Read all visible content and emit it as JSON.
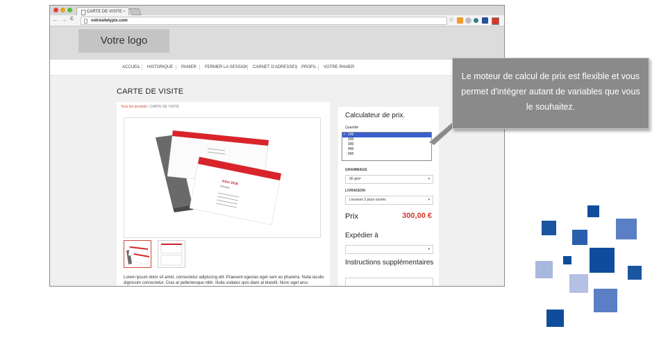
{
  "browser": {
    "tab_title": "CARTE DE VISITE",
    "tab_close": "×",
    "url": "votresitelypix.com",
    "nav_back": "←",
    "nav_forward": "→",
    "nav_reload": "C",
    "bookmark": "☆"
  },
  "site": {
    "logo_text": "Votre logo",
    "menu": [
      "ACCUEIL",
      "HISTORIQUE",
      "PANIER",
      "FERMER LA SESSION",
      "CARNET D'ADRESSES",
      "PROFIL",
      "VOTRE PANIER"
    ]
  },
  "product": {
    "title": "CARTE DE VISITE",
    "breadcrumb_link": "Tous les produits",
    "breadcrumb_sep": "/",
    "breadcrumb_current": "CARTE DE VISITE",
    "description": "Lorem ipsum dolor sit amet, consectetur adipiscing elit. Praesent egestas eget sem eu pharetra. Nulla iaculis dignissim consectetur. Cras at pellentesque nibh. Nulla sodales quis diam at blandit. Nunc eget arcu",
    "card_name": "John DOE",
    "card_role": "Manager"
  },
  "calculator": {
    "title": "Calculateur de prix.",
    "quantity_label": "Quantité",
    "quantity_options": [
      "100",
      "200",
      "300",
      "400",
      "500"
    ],
    "quantity_selected_mark": "✓",
    "paper_label": "GRAMMAGE",
    "paper_value": "90 g/m²",
    "delivery_label": "LIVRAISON",
    "delivery_value": "Livraison 3 jours ouvrés",
    "price_label": "Prix",
    "price_value": "300,00 €",
    "ship_label": "Expédier à",
    "instructions_label": "Instructions supplémentaires",
    "chevron": "▾"
  },
  "callout": {
    "text": "Le moteur de calcul de prix est flexible et vous permet d'intégrer autant de variables que vous le souhaitez."
  },
  "colors": {
    "accent_red": "#d4362a",
    "callout_gray": "#8a8a8a",
    "deco_blue_dark": "#0f4d9c",
    "deco_blue_mid": "#5a7fc4",
    "deco_blue_light": "#a8b7de"
  }
}
